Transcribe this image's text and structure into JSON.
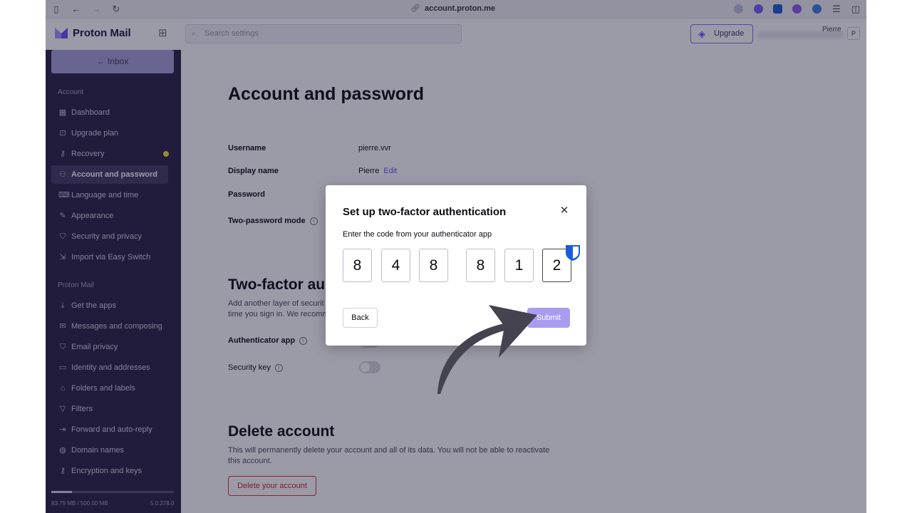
{
  "browser": {
    "url": "account.proton.me"
  },
  "header": {
    "app_name": "Proton Mail",
    "search_placeholder": "Search settings",
    "upgrade_label": "Upgrade",
    "user_name": "Pierre",
    "avatar_initial": "P"
  },
  "sidebar": {
    "inbox_label": "← Inbox",
    "account_section": "Account",
    "account_items": [
      {
        "label": "Dashboard",
        "icon": "dashboard-icon"
      },
      {
        "label": "Upgrade plan",
        "icon": "upgrade-icon"
      },
      {
        "label": "Recovery",
        "icon": "key-icon"
      },
      {
        "label": "Account and password",
        "icon": "user-icon"
      },
      {
        "label": "Language and time",
        "icon": "language-icon"
      },
      {
        "label": "Appearance",
        "icon": "paint-icon"
      },
      {
        "label": "Security and privacy",
        "icon": "shield-icon"
      },
      {
        "label": "Import via Easy Switch",
        "icon": "import-icon"
      }
    ],
    "mail_section": "Proton Mail",
    "mail_items": [
      {
        "label": "Get the apps",
        "icon": "download-icon"
      },
      {
        "label": "Messages and composing",
        "icon": "envelope-icon"
      },
      {
        "label": "Email privacy",
        "icon": "shield-icon"
      },
      {
        "label": "Identity and addresses",
        "icon": "id-card-icon"
      },
      {
        "label": "Folders and labels",
        "icon": "tag-icon"
      },
      {
        "label": "Filters",
        "icon": "filter-icon"
      },
      {
        "label": "Forward and auto-reply",
        "icon": "forward-icon"
      },
      {
        "label": "Domain names",
        "icon": "globe-icon"
      },
      {
        "label": "Encryption and keys",
        "icon": "key-icon"
      }
    ],
    "storage": "83.79 MB / 500.00 MB",
    "storage_fraction": 0.17,
    "version": "5.0.278.0"
  },
  "main": {
    "title": "Account and password",
    "username_label": "Username",
    "username_value": "pierre.vvr",
    "display_name_label": "Display name",
    "display_name_value": "Pierre",
    "edit_label": "Edit",
    "password_label": "Password",
    "two_password_label": "Two-password mode",
    "two_factor_title": "Two-factor au",
    "two_factor_desc_1": "Add another layer of securit",
    "two_factor_desc_2": "time you sign in. We recomm",
    "authenticator_label": "Authenticator app",
    "security_key_label": "Security key",
    "delete_title": "Delete account",
    "delete_desc_1": "This will permanently delete your account and all of its data. You will not be able to reactivate",
    "delete_desc_2": "this account.",
    "delete_button": "Delete your account"
  },
  "modal": {
    "title": "Set up two-factor authentication",
    "subtitle": "Enter the code from your authenticator app",
    "digits": [
      "8",
      "4",
      "8",
      "8",
      "1",
      "2"
    ],
    "back_label": "Back",
    "submit_label": "Submit"
  }
}
